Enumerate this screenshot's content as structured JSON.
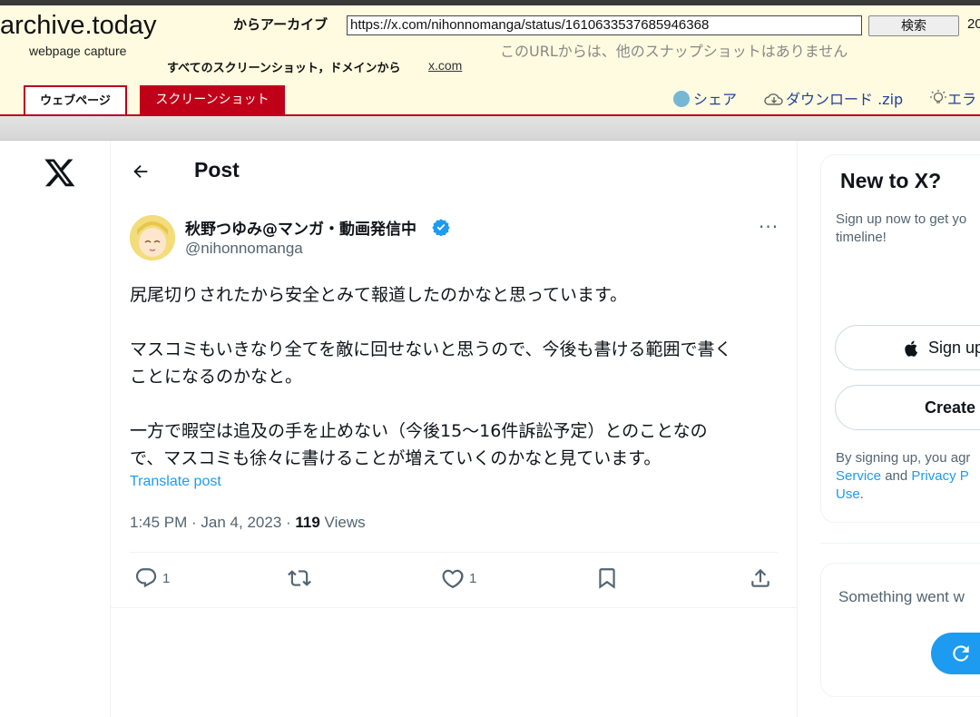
{
  "archive": {
    "logo": "archive.today",
    "logo_sub": "webpage capture",
    "archive_from_label": "からアーカイブ",
    "url": "https://x.com/nihonnomanga/status/1610633537685946368",
    "search_label": "検索",
    "year_fragment": "20",
    "no_other_snapshots": "このURLからは、他のスナップショットはありません",
    "all_screenshots_label": "すべてのスクリーンショット，ドメインから",
    "domain_link": "x.com",
    "tab_webpage": "ウェブページ",
    "tab_screenshot": "スクリーンショット",
    "share_label": "シェア",
    "download_label": "ダウンロード .zip",
    "report_label": "エラ"
  },
  "post": {
    "header_title": "Post",
    "display_name": "秋野つゆみ@マンガ・動画発信中",
    "handle": "@nihonnomanga",
    "text_lines": [
      "尻尾切りされたから安全とみて報道したのかなと思っています。",
      "マスコミもいきなり全てを敵に回せないと思うので、今後も書ける範囲で書く",
      "ことになるのかなと。",
      "一方で暇空は追及の手を止めない（今後15〜16件訴訟予定）とのことなの",
      "で、マスコミも徐々に書けることが増えていくのかなと見ています。"
    ],
    "translate_label": "Translate post",
    "timestamp": "1:45 PM · Jan 4, 2023 · ",
    "views_count": "119",
    "views_label": " Views",
    "reply_count": "1",
    "like_count": "1"
  },
  "sidebar": {
    "title": "New to X?",
    "desc_line1": "Sign up now to get yo",
    "desc_line2": "timeline!",
    "apple_label": "Sign up",
    "create_label": "Create",
    "terms_line1": "By signing up, you agr",
    "terms_line2_link": "Service",
    "terms_line2_and": " and ",
    "terms_line2_privacy": "Privacy P",
    "terms_line3_link": "Use",
    "terms_line3_end": ".",
    "error_text": "Something went w"
  },
  "colors": {
    "archive_bg": "#fffbe0",
    "archive_red": "#c00018",
    "x_blue": "#1d9bf0",
    "muted": "#536471"
  }
}
